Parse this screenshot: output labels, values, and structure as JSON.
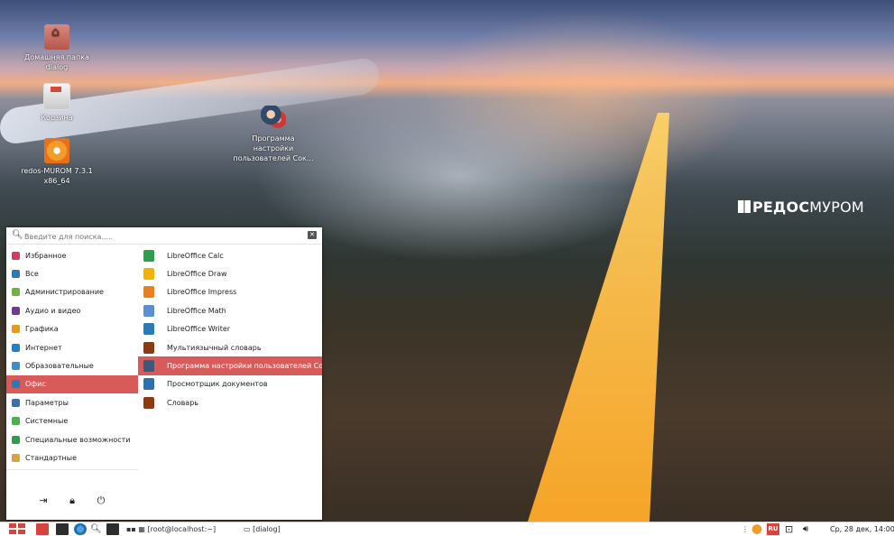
{
  "desktop": {
    "icons": [
      {
        "label": "Домашняя папка dialog"
      },
      {
        "label": "Корзина"
      },
      {
        "label": "redos-MUROM 7.3.1 x86_64"
      },
      {
        "label": "Программа настройки пользователей Сок..."
      }
    ],
    "brand": {
      "part1": "РЕД",
      "part2": "ОС",
      "part3": "МУРОМ"
    }
  },
  "menu": {
    "search": {
      "placeholder": "Введите для поиска....."
    },
    "categories": [
      {
        "label": "Избранное",
        "color": "#d63c5e"
      },
      {
        "label": "Все",
        "color": "#2a7ab8"
      },
      {
        "label": "Администрирование",
        "color": "#6db33f"
      },
      {
        "label": "Аудио и видео",
        "color": "#6a3d8f"
      },
      {
        "label": "Графика",
        "color": "#e79a1f"
      },
      {
        "label": "Интернет",
        "color": "#1f7fd1"
      },
      {
        "label": "Образовательные",
        "color": "#3a8fd1"
      },
      {
        "label": "Офис",
        "color": "#2a7ab8"
      },
      {
        "label": "Параметры",
        "color": "#3a6fb0"
      },
      {
        "label": "Системные",
        "color": "#4caf50"
      },
      {
        "label": "Специальные возможности",
        "color": "#2e9e4c"
      },
      {
        "label": "Стандартные",
        "color": "#d9a43a"
      }
    ],
    "apps": [
      {
        "label": "LibreOffice Calc",
        "color": "#2e9e4c"
      },
      {
        "label": "LibreOffice Draw",
        "color": "#f0b400"
      },
      {
        "label": "LibreOffice Impress",
        "color": "#e8801f"
      },
      {
        "label": "LibreOffice Math",
        "color": "#5a8fd0"
      },
      {
        "label": "LibreOffice Writer",
        "color": "#2a7ab8"
      },
      {
        "label": "Мультиязычный словарь",
        "color": "#8a3b12"
      },
      {
        "label": "Программа настройки пользователей Сок...",
        "color": "#3a5a7a"
      },
      {
        "label": "Просмотрщик документов",
        "color": "#2e6fb0"
      },
      {
        "label": "Словарь",
        "color": "#8a3b12"
      }
    ],
    "bottom_icons": [
      "logout-icon",
      "lock-icon",
      "power-icon"
    ]
  },
  "taskbar": {
    "windows": [
      {
        "label": "[root@localhost:~]"
      },
      {
        "label": "[dialog]"
      }
    ],
    "keyboard_layout": "RU",
    "clock": "Ср, 28 дек, 14:00"
  },
  "colors": {
    "accent": "#d85b5b"
  }
}
